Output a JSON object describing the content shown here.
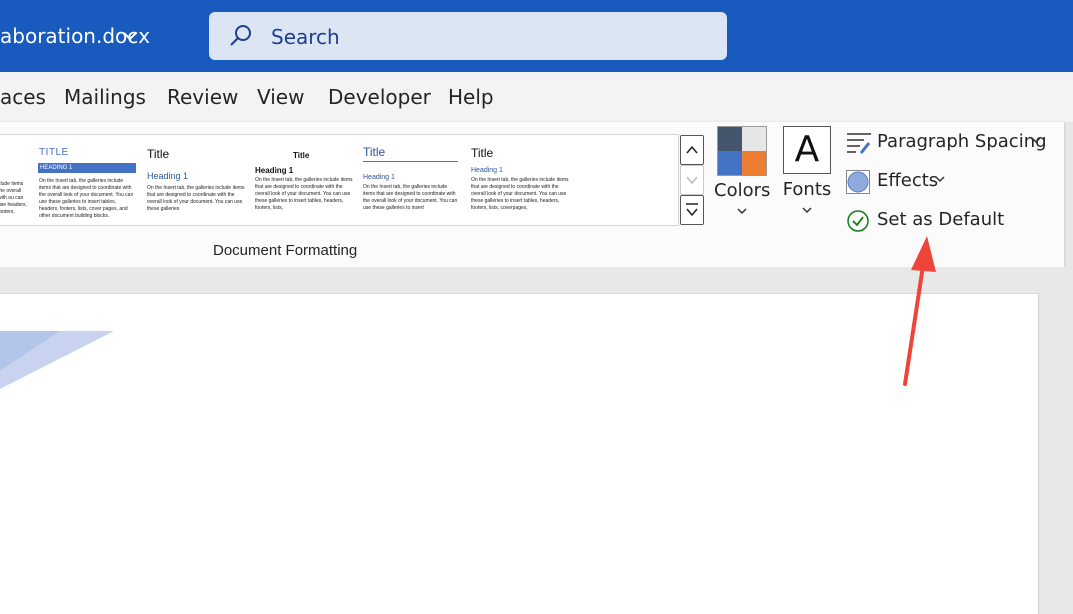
{
  "titlebar": {
    "doc_title": "aboration.docx",
    "search_placeholder": "Search"
  },
  "tabs": [
    {
      "label": "aces"
    },
    {
      "label": "Mailings"
    },
    {
      "label": "Review"
    },
    {
      "label": "View"
    },
    {
      "label": "Developer"
    },
    {
      "label": "Help"
    }
  ],
  "gallery": {
    "thumbs": [
      {
        "title": "",
        "heading": "",
        "body": "clude items\nthe overall\nwith\nou can use\nheaders,\nfooters,"
      },
      {
        "title": "TITLE",
        "heading": "HEADING 1",
        "body": "On the Insert tab, the galleries include items that are designed to coordinate with the overall look of your document. You can use these galleries to insert tables, headers, footers, lists, cover pages, and other document building blocks."
      },
      {
        "title": "Title",
        "heading": "Heading 1",
        "body": "On the Insert tab, the galleries include items that are designed to coordinate with the overall look of your document. You can use these galleries"
      },
      {
        "title": "Title",
        "heading": "Heading 1",
        "body": "On the Insert tab, the galleries include items that are designed to coordinate with the overall look of your document. You can use these galleries to insert tables, headers, footers, lists,"
      },
      {
        "title": "Title",
        "heading": "Heading 1",
        "body": "On the Insert tab, the galleries include items that are designed to coordinate with the overall look of your document. You can use these galleries to insert"
      },
      {
        "title": "Title",
        "heading": "Heading 1",
        "body": "On the Insert tab, the galleries include items that are designed to coordinate with the overall look of your document. You can use these galleries to insert tables, headers, footers, lists, coverpages,"
      }
    ],
    "group_label": "Document Formatting"
  },
  "design": {
    "colors_label": "Colors",
    "fonts_label": "Fonts",
    "fonts_glyph": "A",
    "paragraph_spacing_label": "Paragraph Spacing",
    "effects_label": "Effects",
    "set_default_label": "Set as Default"
  },
  "colors": {
    "accent": "#185abd",
    "arrow": "#f0433a",
    "swatch": [
      "#44546a",
      "#e7e6e6",
      "#4472c4",
      "#ed7d31"
    ]
  }
}
